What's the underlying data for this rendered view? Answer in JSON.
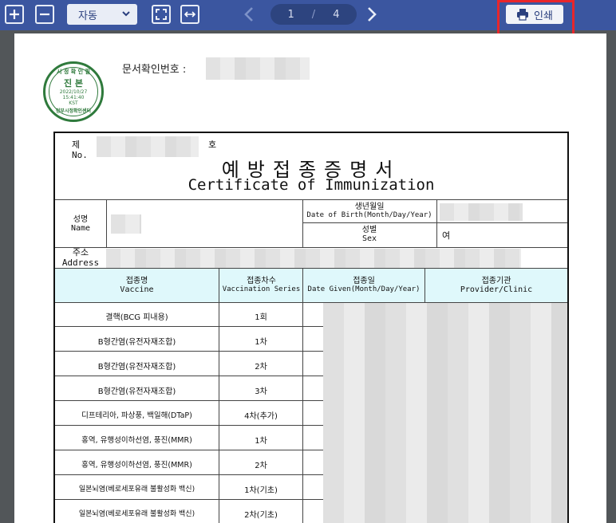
{
  "toolbar": {
    "zoom_in": "+",
    "zoom_out": "−",
    "zoom_value": "자동",
    "current_page": "1",
    "page_separator": "/",
    "total_pages": "4",
    "print_label": "인쇄"
  },
  "document": {
    "doc_number_label": "문서확인번호 :",
    "stamp": {
      "top": "시 정 확 인 필",
      "main": "진 본",
      "date": "2022/10/27",
      "time": "15:41:40",
      "tz": "KST",
      "bottom": "정부시정확인센터"
    },
    "certificate": {
      "no_ko": "제",
      "no_en": "No.",
      "no_suffix": "호",
      "title_ko": "예방접종증명서",
      "title_en": "Certificate of Immunization",
      "name_ko": "성명",
      "name_en": "Name",
      "dob_ko": "생년월일",
      "dob_en": "Date of Birth(Month/Day/Year)",
      "sex_ko": "성별",
      "sex_en": "Sex",
      "sex_value": "여",
      "address_ko": "주소",
      "address_en": "Address",
      "columns": [
        {
          "ko": "접종명",
          "en": "Vaccine"
        },
        {
          "ko": "접종차수",
          "en": "Vaccination Series"
        },
        {
          "ko": "접종일",
          "en": "Date Given(Month/Day/Year)"
        },
        {
          "ko": "접종기관",
          "en": "Provider/Clinic"
        }
      ],
      "rows": [
        {
          "vaccine": "결핵(BCG 피내용)",
          "series": "1회"
        },
        {
          "vaccine": "B형간염(유전자재조합)",
          "series": "1차"
        },
        {
          "vaccine": "B형간염(유전자재조합)",
          "series": "2차"
        },
        {
          "vaccine": "B형간염(유전자재조합)",
          "series": "3차"
        },
        {
          "vaccine": "디프테리아, 파상풍, 백일해(DTaP)",
          "series": "4차(추가)"
        },
        {
          "vaccine": "홍역, 유행성이하선염, 풍진(MMR)",
          "series": "1차"
        },
        {
          "vaccine": "홍역, 유행성이하선염, 풍진(MMR)",
          "series": "2차"
        },
        {
          "vaccine": "일본뇌염(베로세포유래 불활성화 백신)",
          "series": "1차(기초)"
        },
        {
          "vaccine": "일본뇌염(베로세포유래 불활성화 백신)",
          "series": "2차(기초)"
        }
      ]
    }
  },
  "colors": {
    "toolbar_bg": "#3b56a0",
    "viewer_bg": "#525659",
    "highlight": "#e8262b",
    "table_header_bg": "#dff8fb",
    "stamp": "#2f7a3c"
  }
}
